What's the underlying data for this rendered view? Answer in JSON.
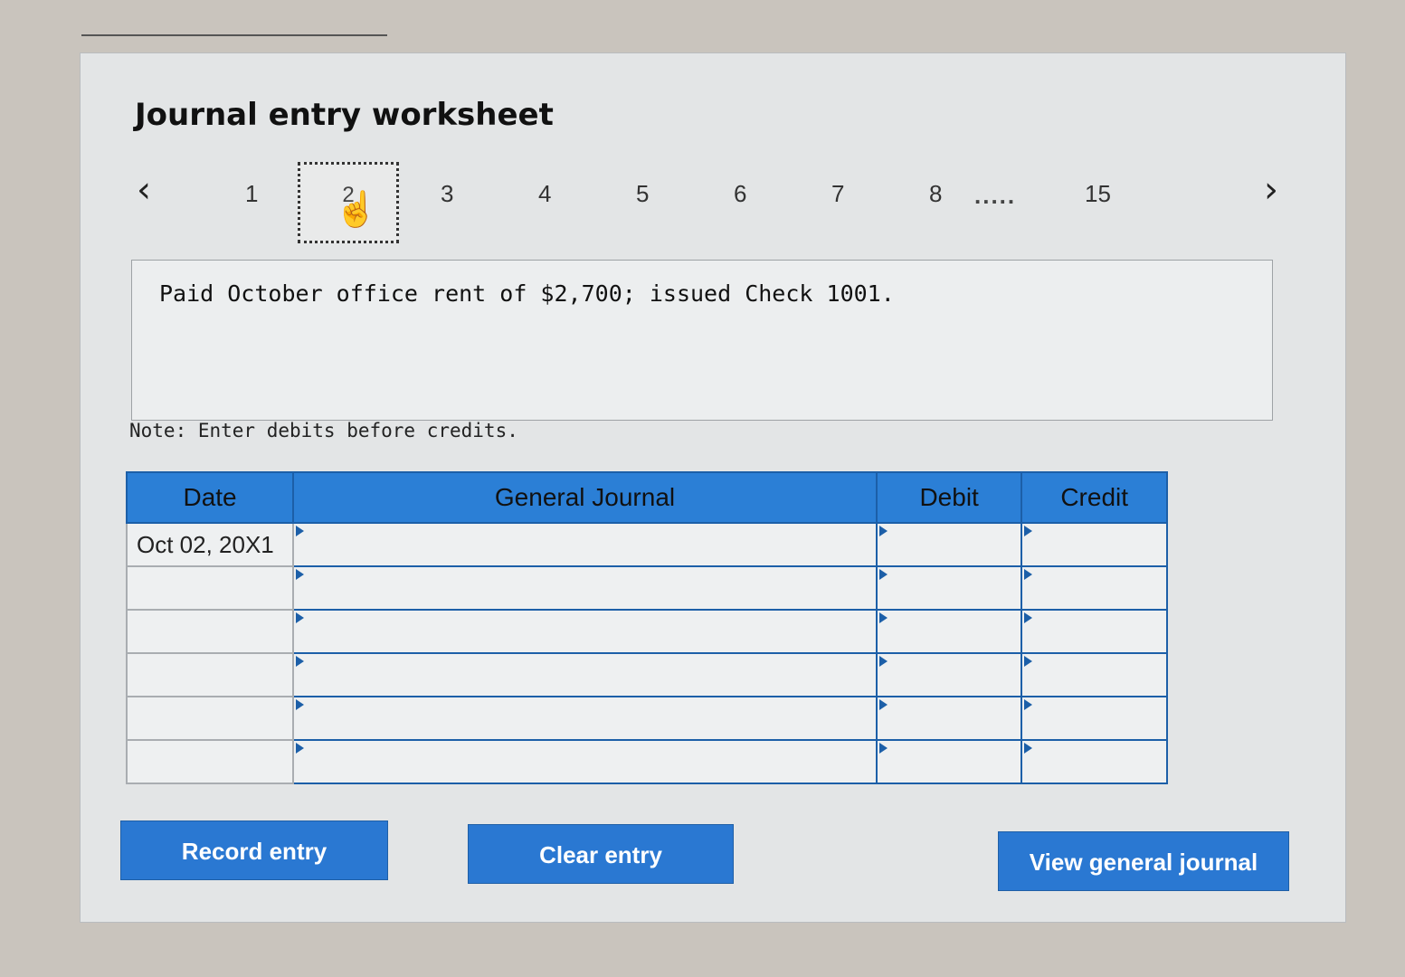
{
  "worksheet": {
    "title": "Journal entry worksheet",
    "pager": {
      "prev": "‹",
      "next": "›",
      "pages": [
        "1",
        "2",
        "3",
        "4",
        "5",
        "6",
        "7",
        "8"
      ],
      "active_page": "2",
      "ellipsis": ".....",
      "last_page": "15"
    },
    "transaction": "Paid October office rent of $2,700; issued Check 1001.",
    "note": "Note: Enter debits before credits.",
    "table": {
      "headers": [
        "Date",
        "General Journal",
        "Debit",
        "Credit"
      ],
      "rows": [
        {
          "date": "Oct 02, 20X1",
          "account": "",
          "debit": "",
          "credit": ""
        },
        {
          "date": "",
          "account": "",
          "debit": "",
          "credit": ""
        },
        {
          "date": "",
          "account": "",
          "debit": "",
          "credit": ""
        },
        {
          "date": "",
          "account": "",
          "debit": "",
          "credit": ""
        },
        {
          "date": "",
          "account": "",
          "debit": "",
          "credit": ""
        },
        {
          "date": "",
          "account": "",
          "debit": "",
          "credit": ""
        }
      ]
    },
    "buttons": {
      "record": "Record entry",
      "clear": "Clear entry",
      "view": "View general journal"
    }
  },
  "colors": {
    "accent": "#2b7fd6",
    "button": "#2a78d2",
    "panel": "#e3e5e6"
  }
}
